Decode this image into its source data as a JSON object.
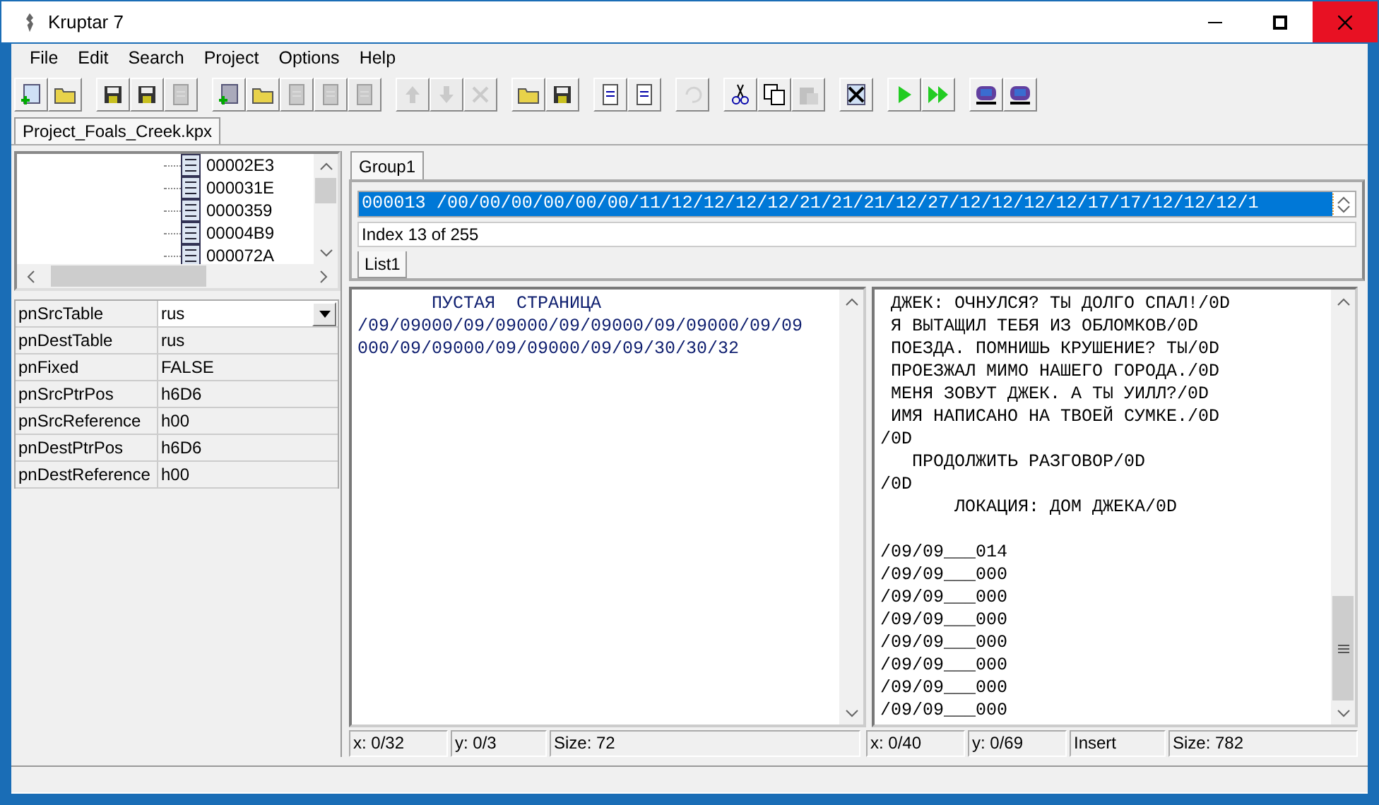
{
  "window": {
    "title": "Kruptar 7"
  },
  "menu": [
    "File",
    "Edit",
    "Search",
    "Project",
    "Options",
    "Help"
  ],
  "toolbar": [
    [
      {
        "kind": "new",
        "disabled": false
      },
      {
        "kind": "open",
        "disabled": false
      }
    ],
    [
      {
        "kind": "save",
        "disabled": false
      },
      {
        "kind": "save-all",
        "disabled": false
      },
      {
        "kind": "close",
        "disabled": true
      }
    ],
    [
      {
        "kind": "add-rom",
        "disabled": false
      },
      {
        "kind": "add-folder",
        "disabled": false
      },
      {
        "kind": "doc",
        "disabled": true
      },
      {
        "kind": "doc",
        "disabled": true
      },
      {
        "kind": "doc",
        "disabled": true
      }
    ],
    [
      {
        "kind": "up",
        "disabled": true
      },
      {
        "kind": "down",
        "disabled": true
      },
      {
        "kind": "delete",
        "disabled": true
      }
    ],
    [
      {
        "kind": "open",
        "disabled": false
      },
      {
        "kind": "save",
        "disabled": false
      }
    ],
    [
      {
        "kind": "import",
        "disabled": false
      },
      {
        "kind": "swap",
        "disabled": false
      }
    ],
    [
      {
        "kind": "undo",
        "disabled": true
      }
    ],
    [
      {
        "kind": "cut",
        "disabled": false
      },
      {
        "kind": "copy",
        "disabled": false
      },
      {
        "kind": "paste",
        "disabled": true
      }
    ],
    [
      {
        "kind": "clear",
        "disabled": false
      }
    ],
    [
      {
        "kind": "play",
        "disabled": false
      },
      {
        "kind": "play-all",
        "disabled": false
      }
    ],
    [
      {
        "kind": "input",
        "disabled": false
      },
      {
        "kind": "output",
        "disabled": false
      }
    ]
  ],
  "project_tab": "Project_Foals_Creek.kpx",
  "tree": {
    "items": [
      "00002E3",
      "000031E",
      "0000359",
      "00004B9",
      "000072A"
    ]
  },
  "properties": [
    {
      "name": "pnSrcTable",
      "value": "rus",
      "kind": "dropdown"
    },
    {
      "name": "pnDestTable",
      "value": "rus",
      "kind": "text"
    },
    {
      "name": "pnFixed",
      "value": "FALSE",
      "kind": "text"
    },
    {
      "name": "pnSrcPtrPos",
      "value": "h6D6",
      "kind": "text"
    },
    {
      "name": "pnSrcReference",
      "value": "h00",
      "kind": "text"
    },
    {
      "name": "pnDestPtrPos",
      "value": "h6D6",
      "kind": "text"
    },
    {
      "name": "pnDestReference",
      "value": "h00",
      "kind": "text"
    }
  ],
  "group_tab": "Group1",
  "pointer_string": "000013 /00/00/00/00/00/00/11/12/12/12/12/21/21/21/12/27/12/12/12/12/17/17/12/12/12/1",
  "index_label": "Index 13 of 255",
  "list_tab": "List1",
  "source_text": [
    "       ПУСТАЯ  СТРАНИЦА",
    "/09/09000/09/09000/09/09000/09/09000/09/09",
    "000/09/09000/09/09000/09/09/30/30/32"
  ],
  "dest_text": [
    " ДЖЕК: ОЧНУЛСЯ? ТЫ ДОЛГО СПАЛ!/0D",
    " Я ВЫТАЩИЛ ТЕБЯ ИЗ ОБЛОМКОВ/0D",
    " ПОЕЗДА. ПОМНИШЬ КРУШЕНИЕ? ТЫ/0D",
    " ПРОЕЗЖАЛ МИМО НАШЕГО ГОРОДА./0D",
    " МЕНЯ ЗОВУТ ДЖЕК. А ТЫ УИЛЛ?/0D",
    " ИМЯ НАПИСАНО НА ТВОЕЙ СУМКЕ./0D",
    "/0D",
    "   ПРОДОЛЖИТЬ РАЗГОВОР/0D",
    "/0D",
    "       ЛОКАЦИЯ: ДОМ ДЖЕКА/0D"
  ],
  "dest_codes": [
    "/09/09___014",
    "/09/09___000",
    "/09/09___000",
    "/09/09___000",
    "/09/09___000",
    "/09/09___000",
    "/09/09___000",
    "/09/09___000"
  ],
  "source_status": [
    "x: 0/32",
    "y: 0/3",
    "Size: 72"
  ],
  "dest_status": [
    "x: 0/40",
    "y: 0/69",
    "Insert",
    "Size: 782"
  ]
}
